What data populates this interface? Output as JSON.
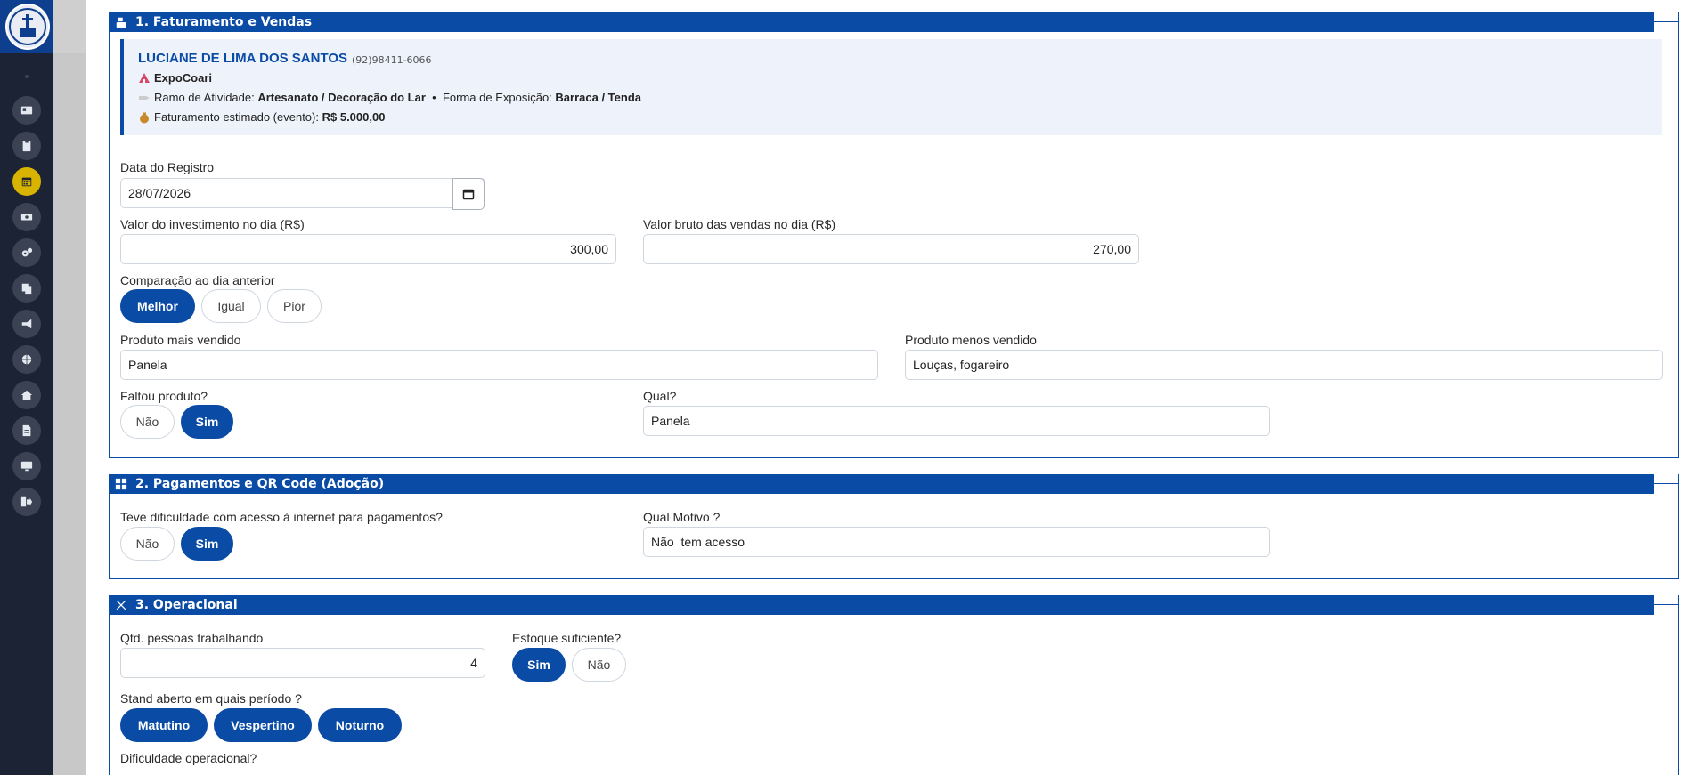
{
  "sidebar": {
    "items": [
      {
        "icon": "id-card-icon"
      },
      {
        "icon": "clipboard-icon"
      },
      {
        "icon": "calendar-icon",
        "active": true
      },
      {
        "icon": "money-icon"
      },
      {
        "icon": "gears-icon"
      },
      {
        "icon": "copy-icon"
      },
      {
        "icon": "megaphone-icon"
      },
      {
        "icon": "globe-icon"
      },
      {
        "icon": "home-icon"
      },
      {
        "icon": "file-icon"
      },
      {
        "icon": "monitor-icon"
      },
      {
        "icon": "logout-icon"
      }
    ]
  },
  "section1": {
    "title": "1. Faturamento e Vendas",
    "card": {
      "name": "LUCIANE DE LIMA DOS SANTOS",
      "phone": "(92)98411-6066",
      "event": "ExpoCoari",
      "ramo_label": "Ramo de Atividade:",
      "ramo_value": "Artesanato / Decoração do Lar",
      "sep": "•",
      "forma_label": "Forma de Exposição:",
      "forma_value": "Barraca / Tenda",
      "fat_label": "Faturamento estimado (evento):",
      "fat_value": "R$ 5.000,00"
    },
    "data_label": "Data do Registro",
    "data_value": "28/07/2026",
    "invest_label": "Valor do investimento no dia (R$)",
    "invest_value": "300,00",
    "bruto_label": "Valor bruto das vendas no dia (R$)",
    "bruto_value": "270,00",
    "comp_label": "Comparação ao dia anterior",
    "comp_options": [
      "Melhor",
      "Igual",
      "Pior"
    ],
    "comp_selected": "Melhor",
    "mais_label": "Produto mais vendido",
    "mais_value": "Panela",
    "menos_label": "Produto menos vendido",
    "menos_value": "Louças, fogareiro",
    "faltou_label": "Faltou produto?",
    "faltou_options": [
      "Não",
      "Sim"
    ],
    "faltou_selected": "Sim",
    "qual_label": "Qual?",
    "qual_value": "Panela"
  },
  "section2": {
    "title": "2. Pagamentos e QR Code (Adoção)",
    "internet_label": "Teve dificuldade com acesso à internet para pagamentos?",
    "internet_options": [
      "Não",
      "Sim"
    ],
    "internet_selected": "Sim",
    "motivo_label": "Qual Motivo ?",
    "motivo_value": "Não  tem acesso"
  },
  "section3": {
    "title": "3. Operacional",
    "pessoas_label": "Qtd. pessoas trabalhando",
    "pessoas_value": "4",
    "estoque_label": "Estoque suficiente?",
    "estoque_options": [
      "Sim",
      "Não"
    ],
    "estoque_selected": "Sim",
    "periodo_label": "Stand aberto em quais período ?",
    "periodo_options": [
      "Matutino",
      "Vespertino",
      "Noturno"
    ],
    "dificuldade_label": "Dificuldade operacional?"
  },
  "colors": {
    "primary": "#0a4ba5",
    "sidebar": "#1b2334",
    "active_nav": "#d8b300"
  }
}
